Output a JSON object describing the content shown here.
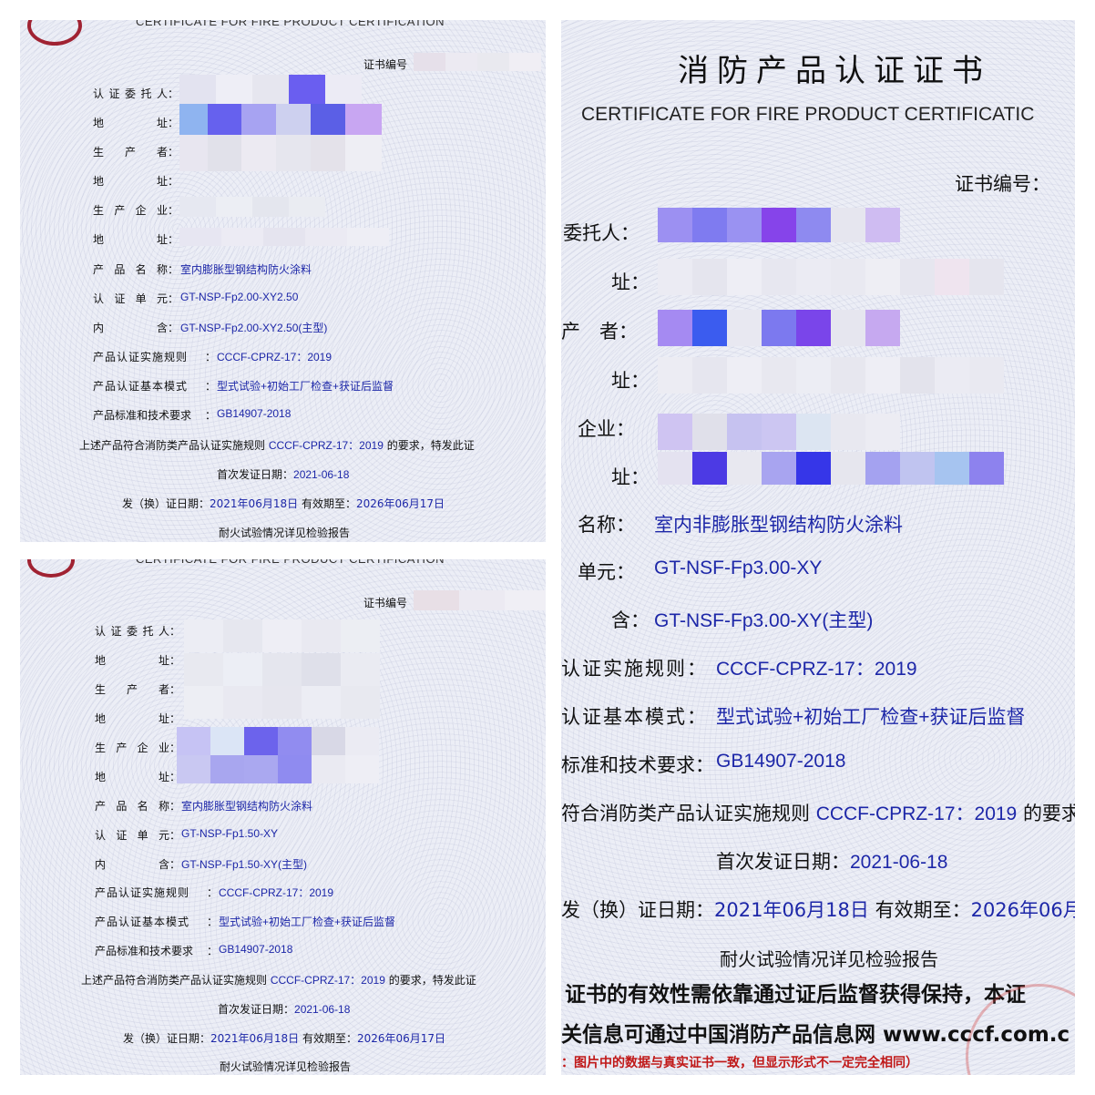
{
  "small": {
    "cert_title": "CERTIFICATE FOR FIRE PRODUCT CERTIFICATION",
    "cert_no_label": "证书编号",
    "labels": {
      "client": [
        "认",
        "证",
        "委",
        "托",
        "人"
      ],
      "address": [
        "地",
        "址"
      ],
      "producer": [
        "生",
        "产",
        "者"
      ],
      "factory": [
        "生",
        "产",
        "企",
        "业"
      ],
      "product_name": [
        "产",
        "品",
        "名",
        "称"
      ],
      "cert_unit": [
        "认",
        "证",
        "单",
        "元"
      ],
      "contains": [
        "内",
        "含"
      ],
      "rule": "产品认证实施规则",
      "mode": "产品认证基本模式",
      "standard": "产品标准和技术要求",
      "colon": "："
    },
    "conform_pre": "上述产品符合消防类产品认证实施规则",
    "conform_rule": "CCCF-CPRZ-17：2019",
    "conform_post": "的要求，特发此证",
    "first_issue_label": "首次发证日期：",
    "issue_label": "发（换）证日期：",
    "valid_label": "有效期至：",
    "test_note": "耐火试验情况详见检验报告"
  },
  "cert1": {
    "product_name": "室内膨胀型钢结构防火涂料",
    "cert_unit": "GT-NSP-Fp2.00-XY2.50",
    "contains": "GT-NSP-Fp2.00-XY2.50(主型)",
    "rule": "CCCF-CPRZ-17：2019",
    "mode": "型式试验+初始工厂检查+获证后监督",
    "standard": "GB14907-2018",
    "first_issue": "2021-06-18",
    "issue_date": "2021年06月18日",
    "valid_until": "2026年06月17日"
  },
  "cert2": {
    "product_name": "室内膨胀型钢结构防火涂料",
    "cert_unit": "GT-NSP-Fp1.50-XY",
    "contains": "GT-NSP-Fp1.50-XY(主型)",
    "rule": "CCCF-CPRZ-17：2019",
    "mode": "型式试验+初始工厂检查+获证后监督",
    "standard": "GB14907-2018",
    "first_issue": "2021-06-18",
    "issue_date": "2021年06月18日",
    "valid_until": "2026年06月17日"
  },
  "cert3": {
    "title": "消防产品认证证书",
    "subtitle": "CERTIFICATE FOR FIRE PRODUCT CERTIFICATIC",
    "cert_no_label": "证书编号：",
    "client_label": "委托人：",
    "address_label": "址：",
    "producer_label": "产　者：",
    "factory_label": "企业：",
    "name_label": "名称：",
    "unit_label": "单元：",
    "contains_label": "含：",
    "rule_label": "认证实施规则：",
    "mode_label": "认证基本模式：",
    "standard_label": "标准和技术要求：",
    "product_name": "室内非膨胀型钢结构防火涂料",
    "cert_unit": "GT-NSF-Fp3.00-XY",
    "contains": "GT-NSF-Fp3.00-XY(主型)",
    "rule": "CCCF-CPRZ-17：2019",
    "mode": "型式试验+初始工厂检查+获证后监督",
    "standard": "GB14907-2018",
    "conform_pre": "符合消防类产品认证实施规则",
    "conform_rule": "CCCF-CPRZ-17：2019",
    "conform_post": "的要求",
    "first_issue_label": "首次发证日期：",
    "first_issue": "2021-06-18",
    "issue_label": "发（换）证日期：",
    "issue_date": "2021年06月18日",
    "valid_label": "有效期至：",
    "valid_until": "2026年06月",
    "test_note": "耐火试验情况详见检验报告",
    "validity_line": "证书的有效性需依靠通过证后监督获得保持，本证",
    "info_line": "关信息可通过中国消防产品信息网 www.cccf.com.c",
    "notice": "：图片中的数据与真实证书一致，但显示形式不一定完全相同）"
  }
}
